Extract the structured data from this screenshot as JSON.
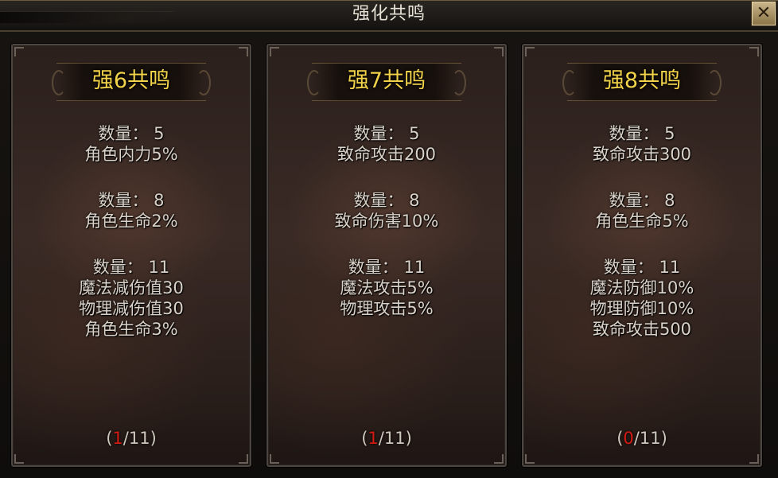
{
  "window": {
    "title": "强化共鸣",
    "close_icon": "close-icon"
  },
  "colors": {
    "title_gold": "#f2d34a",
    "text": "#d9d2c8",
    "progress_current": "#d41a12",
    "close_button": "#c9b58a"
  },
  "panels": [
    {
      "title": "强6共鸣",
      "groups": [
        {
          "lines": [
            "数量： 5",
            "角色内力5%"
          ]
        },
        {
          "lines": [
            "数量： 8",
            "角色生命2%"
          ]
        },
        {
          "lines": [
            "数量： 11",
            "魔法减伤值30",
            "物理减伤值30",
            "角色生命3%"
          ]
        }
      ],
      "progress": {
        "open": "(",
        "current": "1",
        "total": "/11)"
      }
    },
    {
      "title": "强7共鸣",
      "groups": [
        {
          "lines": [
            "数量： 5",
            "致命攻击200"
          ]
        },
        {
          "lines": [
            "数量： 8",
            "致命伤害10%"
          ]
        },
        {
          "lines": [
            "数量： 11",
            "魔法攻击5%",
            "物理攻击5%"
          ]
        }
      ],
      "progress": {
        "open": "(",
        "current": "1",
        "total": "/11)"
      }
    },
    {
      "title": "强8共鸣",
      "groups": [
        {
          "lines": [
            "数量： 5",
            "致命攻击300"
          ]
        },
        {
          "lines": [
            "数量： 8",
            "角色生命5%"
          ]
        },
        {
          "lines": [
            "数量： 11",
            "魔法防御10%",
            "物理防御10%",
            "致命攻击500"
          ]
        }
      ],
      "progress": {
        "open": "(",
        "current": "0",
        "total": "/11)"
      }
    }
  ]
}
